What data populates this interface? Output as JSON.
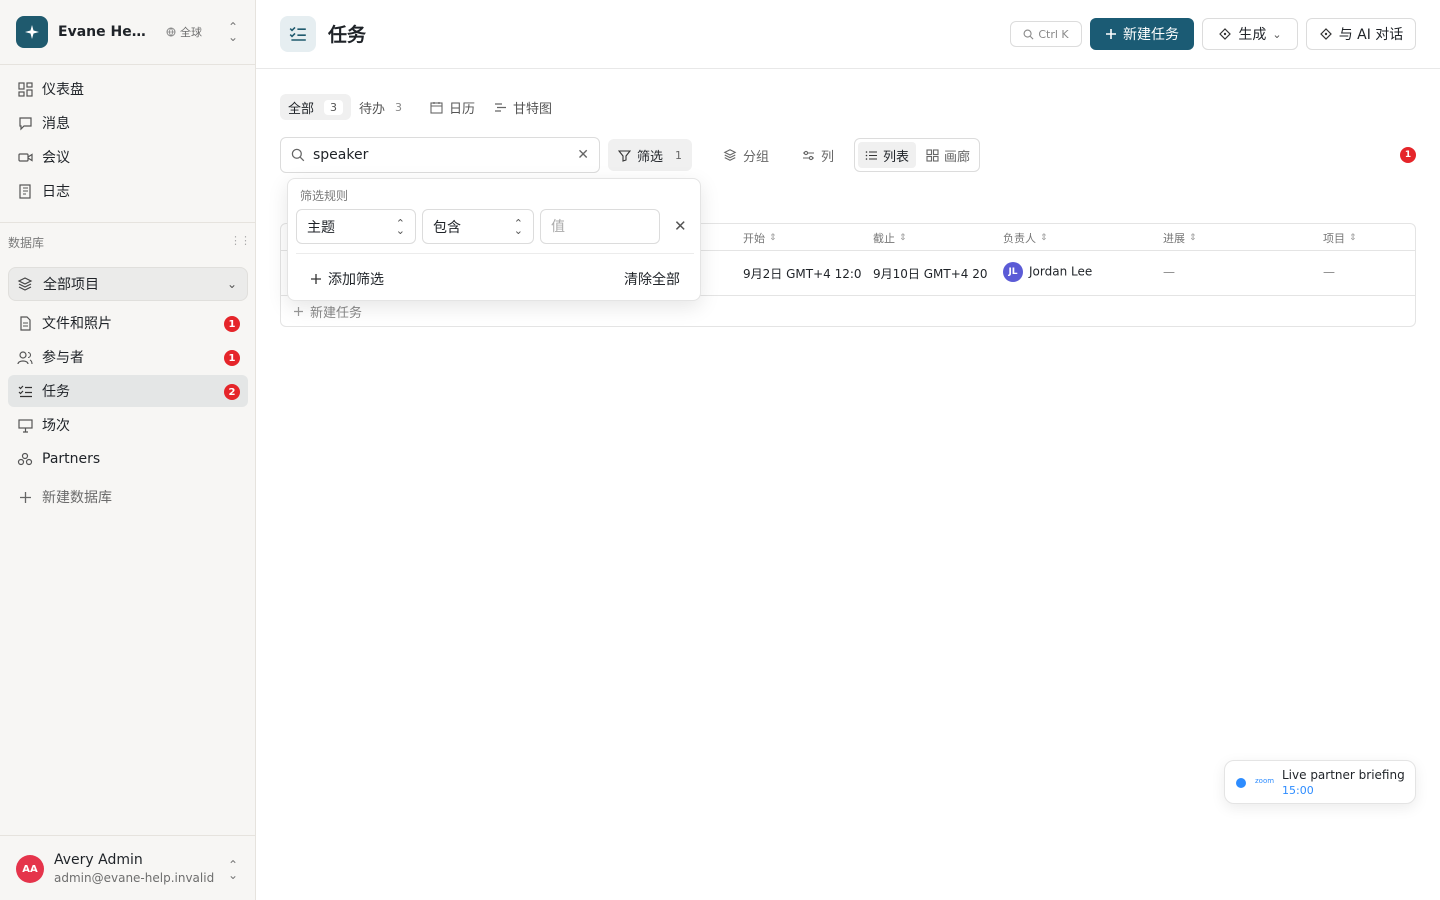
{
  "workspace": {
    "name": "Evane Help Center",
    "scope": "全球"
  },
  "nav": {
    "dashboard": "仪表盘",
    "messages": "消息",
    "meetings": "会议",
    "logs": "日志"
  },
  "database": {
    "section_label": "数据库",
    "all_projects": "全部项目",
    "items": [
      {
        "label": "文件和照片",
        "badge": "1"
      },
      {
        "label": "参与者",
        "badge": "1"
      },
      {
        "label": "任务",
        "badge": "2"
      },
      {
        "label": "场次"
      },
      {
        "label": "Partners"
      }
    ],
    "new_database": "新建数据库"
  },
  "user": {
    "initials": "AA",
    "name": "Avery Admin",
    "email": "admin@evane-help.invalid"
  },
  "header": {
    "title": "任务",
    "shortcut": "Ctrl K",
    "new_task": "新建任务",
    "generate": "生成",
    "ai_chat": "与 AI 对话"
  },
  "tabs": [
    {
      "label": "全部",
      "count": "3"
    },
    {
      "label": "待办",
      "count": "3"
    },
    {
      "label": "日历"
    },
    {
      "label": "甘特图"
    }
  ],
  "toolbar": {
    "search_value": "speaker",
    "filter_label": "筛选",
    "filter_count": "1",
    "group_label": "分组",
    "columns_label": "列",
    "list_label": "列表",
    "gallery_label": "画廊",
    "notification_count": "1"
  },
  "table": {
    "columns": [
      "开始",
      "截止",
      "负责人",
      "进展",
      "项目"
    ],
    "rows": [
      {
        "start": "9月2日 GMT+4 12:0",
        "due": "9月10日 GMT+4 20",
        "assignee_initials": "JL",
        "assignee": "Jordan Lee",
        "progress": "—",
        "project": "—"
      }
    ],
    "new_row": "新建任务"
  },
  "filter_popover": {
    "title": "筛选规则",
    "field": "主题",
    "operator": "包含",
    "value_placeholder": "值",
    "add_filter": "添加筛选",
    "clear_all": "清除全部"
  },
  "meeting_toast": {
    "brand": "zoom",
    "title": "Live partner briefing",
    "time": "15:00"
  },
  "colors": {
    "primary": "#1b5b74",
    "badge": "#e5252a",
    "zoom": "#2d8cff"
  }
}
